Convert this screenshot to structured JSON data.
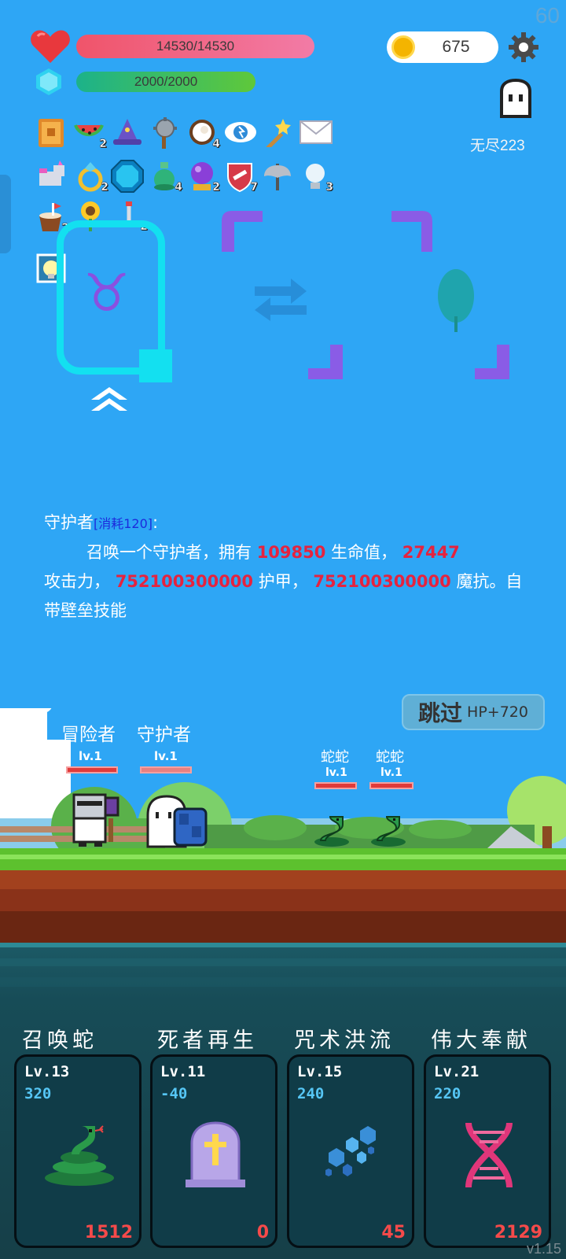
{
  "fps": "60",
  "hp": "14530/14530",
  "mp": "2000/2000",
  "coins": "675",
  "endless_label": "无尽223",
  "items": [
    {
      "icon": "book-icon",
      "count": ""
    },
    {
      "icon": "watermelon-icon",
      "count": "2"
    },
    {
      "icon": "wizard-hat-icon",
      "count": ""
    },
    {
      "icon": "mace-icon",
      "count": ""
    },
    {
      "icon": "coconut-icon",
      "count": "4"
    },
    {
      "icon": "lightning-eye-icon",
      "count": ""
    },
    {
      "icon": "magic-wand-icon",
      "count": ""
    },
    {
      "icon": "envelope-icon",
      "count": ""
    },
    {
      "icon": "unicorn-icon",
      "count": ""
    },
    {
      "icon": "ring-icon",
      "count": "2"
    },
    {
      "icon": "gem-icon",
      "count": ""
    },
    {
      "icon": "potion-icon",
      "count": "4"
    },
    {
      "icon": "crystal-ball-icon",
      "count": "2"
    },
    {
      "icon": "shield-icon",
      "count": "7"
    },
    {
      "icon": "axe-icon",
      "count": ""
    },
    {
      "icon": "lightbulb-icon",
      "count": "3"
    },
    {
      "icon": "drink-icon",
      "count": "2"
    },
    {
      "icon": "sunflower-icon",
      "count": ""
    },
    {
      "icon": "hook-icon",
      "count": "2"
    },
    {
      "icon": "lamp-card-icon",
      "count": ""
    }
  ],
  "description": {
    "name": "守护者",
    "cost": "[消耗120]",
    "colon": ":",
    "t1": "召唤一个守护者，拥有",
    "hp": "109850",
    "t2": "生命值，",
    "atk": "27447",
    "t3": "攻击力，",
    "armor": "752100300000",
    "t4": "护甲，",
    "mres": "752100300000",
    "t5": "魔抗。自带壁垒技能"
  },
  "skip": {
    "label": "跳过",
    "bonus": "HP+720"
  },
  "units": [
    {
      "name": "冒险者",
      "level": "lv.1"
    },
    {
      "name": "守护者",
      "level": "lv.1"
    }
  ],
  "enemies": [
    {
      "name": "蛇蛇",
      "level": "lv.1"
    },
    {
      "name": "蛇蛇",
      "level": "lv.1"
    }
  ],
  "skills": [
    {
      "title": "召唤蛇",
      "level": "Lv.13",
      "cost": "320",
      "count": "1512",
      "icon": "snake-icon"
    },
    {
      "title": "死者再生",
      "level": "Lv.11",
      "cost": "-40",
      "count": "0",
      "icon": "tombstone-icon"
    },
    {
      "title": "咒术洪流",
      "level": "Lv.15",
      "cost": "240",
      "count": "45",
      "icon": "hexagons-icon"
    },
    {
      "title": "伟大奉献",
      "level": "Lv.21",
      "cost": "220",
      "count": "2129",
      "icon": "dna-icon"
    }
  ],
  "version": "v1.15"
}
